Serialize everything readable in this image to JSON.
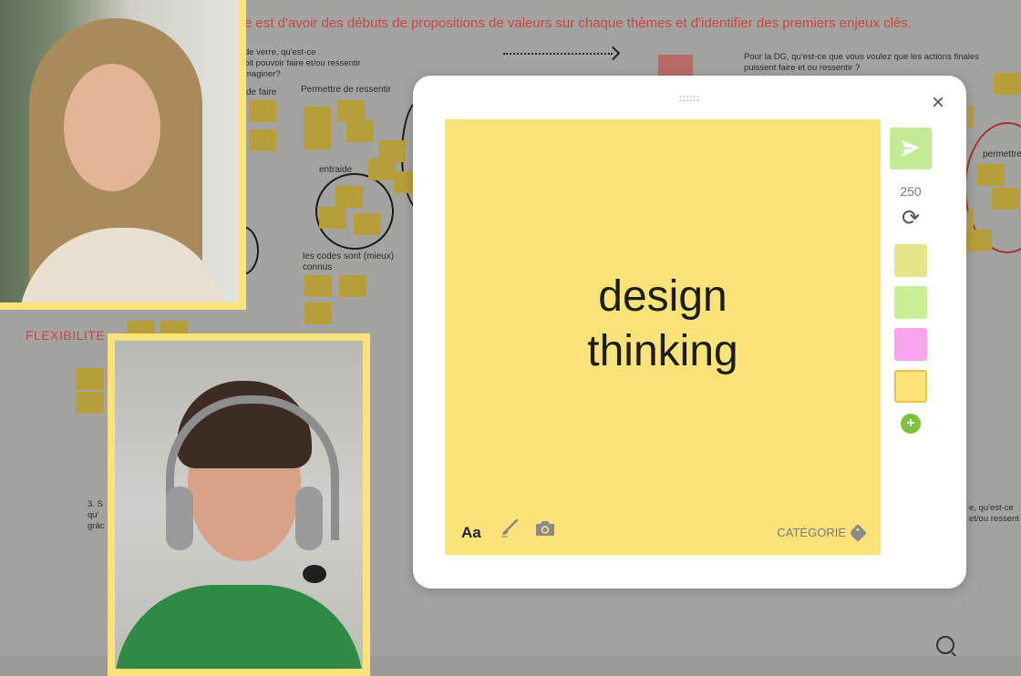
{
  "board": {
    "headline": "e est d'avoir des débuts de propositions de valeurs sur chaque thèmes et d'identifier des premiers enjeux clés.",
    "labels": {
      "verre": "de verre, qu'est-ce\noit pouvoir faire et/ou ressentir\nmaginer?",
      "faire": "de faire",
      "ressentir": "Permettre de ressentir",
      "entraide": "entraide",
      "codes": "les codes sont (mieux)\nconnus",
      "dg": "Pour la DG, qu'est-ce que vous voulez que les actions finales\npuissent faire et ou ressentir ?",
      "permettre_d": "permettre d'a",
      "flex": "FLEXIBILITE",
      "q3": "3.  S\nqu'\ngrâc",
      "q_right": "e, qu'est-ce\net/ou ressent"
    }
  },
  "modal": {
    "drag_handle": "::::::",
    "close": "×",
    "note": {
      "text": "design\nthinking",
      "color": "#fbe37a",
      "font_tool": "Aa",
      "category_label": "CATÉGORIE"
    },
    "sidebar": {
      "char_count": "250",
      "send_color": "#c5ea95",
      "swatches": [
        {
          "name": "swatch-olive",
          "color": "#e6e58a",
          "selected": false
        },
        {
          "name": "swatch-green",
          "color": "#c8ef96",
          "selected": false
        },
        {
          "name": "swatch-pink",
          "color": "#fba4ee",
          "selected": false
        },
        {
          "name": "swatch-yellow",
          "color": "#fbe37a",
          "selected": true
        }
      ],
      "add": "+"
    }
  },
  "icons": [
    "send-icon",
    "refresh-icon",
    "brush-icon",
    "camera-icon",
    "tag-icon",
    "search-icon",
    "close-icon"
  ]
}
